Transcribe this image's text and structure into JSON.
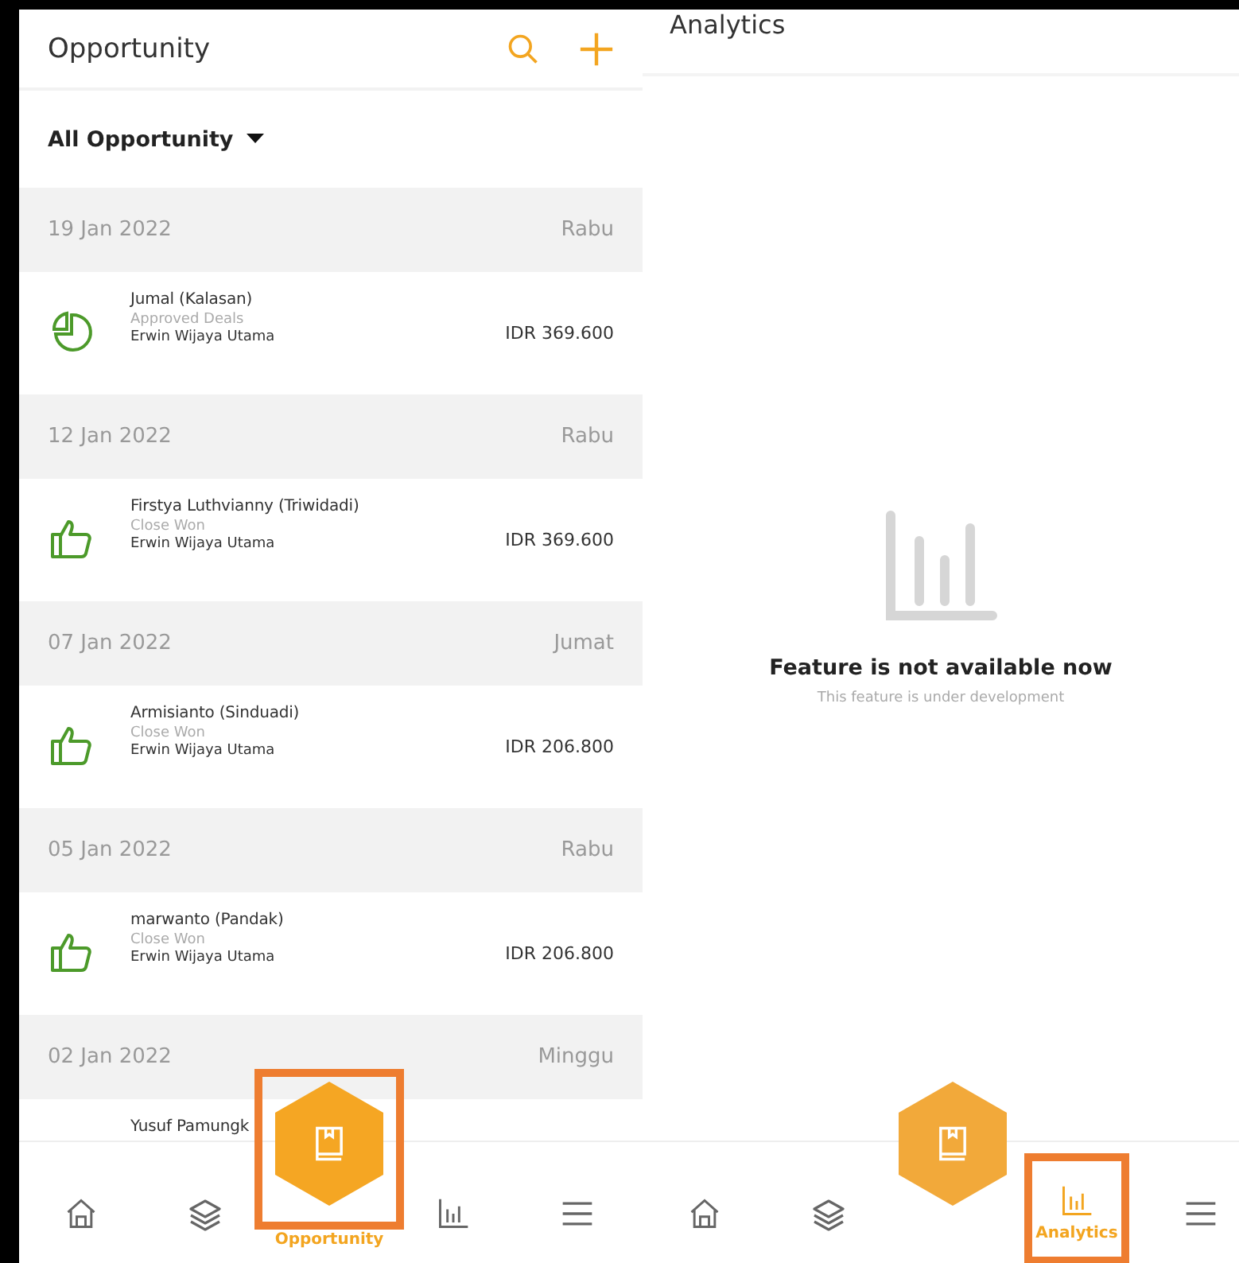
{
  "opportunity_screen": {
    "title": "Opportunity",
    "filter": "All Opportunity",
    "groups": [
      {
        "date": "19 Jan 2022",
        "day": "Rabu",
        "items": [
          {
            "kind": "approved",
            "name": "Jumal (Kalasan)",
            "status": "Approved Deals",
            "owner": "Erwin Wijaya Utama",
            "amount": "IDR 369.600"
          }
        ]
      },
      {
        "date": "12 Jan 2022",
        "day": "Rabu",
        "items": [
          {
            "kind": "won",
            "name": "Firstya Luthvianny (Triwidadi)",
            "status": "Close Won",
            "owner": "Erwin Wijaya Utama",
            "amount": "IDR 369.600"
          }
        ]
      },
      {
        "date": "07 Jan 2022",
        "day": "Jumat",
        "items": [
          {
            "kind": "won",
            "name": "Armisianto (Sinduadi)",
            "status": "Close Won",
            "owner": "Erwin Wijaya Utama",
            "amount": "IDR 206.800"
          }
        ]
      },
      {
        "date": "05 Jan 2022",
        "day": "Rabu",
        "items": [
          {
            "kind": "won",
            "name": "marwanto (Pandak)",
            "status": "Close Won",
            "owner": "Erwin Wijaya Utama",
            "amount": "IDR 206.800"
          }
        ]
      },
      {
        "date": "02 Jan 2022",
        "day": "Minggu",
        "items": [
          {
            "name": "Yusuf Pamungk"
          }
        ]
      }
    ],
    "nav": [
      {
        "kind": "home",
        "selected": false,
        "highlighted": false
      },
      {
        "kind": "layers",
        "selected": false,
        "highlighted": false
      },
      {
        "kind": "opportunity",
        "label": "Opportunity",
        "selected": true,
        "highlighted": true
      },
      {
        "kind": "analytics",
        "selected": false,
        "highlighted": false
      },
      {
        "kind": "menu",
        "selected": false,
        "highlighted": false
      }
    ]
  },
  "analytics_screen": {
    "title": "Analytics",
    "empty_title": "Feature is not available now",
    "empty_subtitle": "This feature is under development",
    "nav": [
      {
        "kind": "home",
        "selected": false,
        "highlighted": false
      },
      {
        "kind": "layers",
        "selected": false,
        "highlighted": false
      },
      {
        "kind": "opportunity",
        "selected": false,
        "highlighted": false
      },
      {
        "kind": "analytics",
        "label": "Analytics",
        "selected": true,
        "highlighted": true
      },
      {
        "kind": "menu",
        "selected": false,
        "highlighted": false
      }
    ]
  }
}
